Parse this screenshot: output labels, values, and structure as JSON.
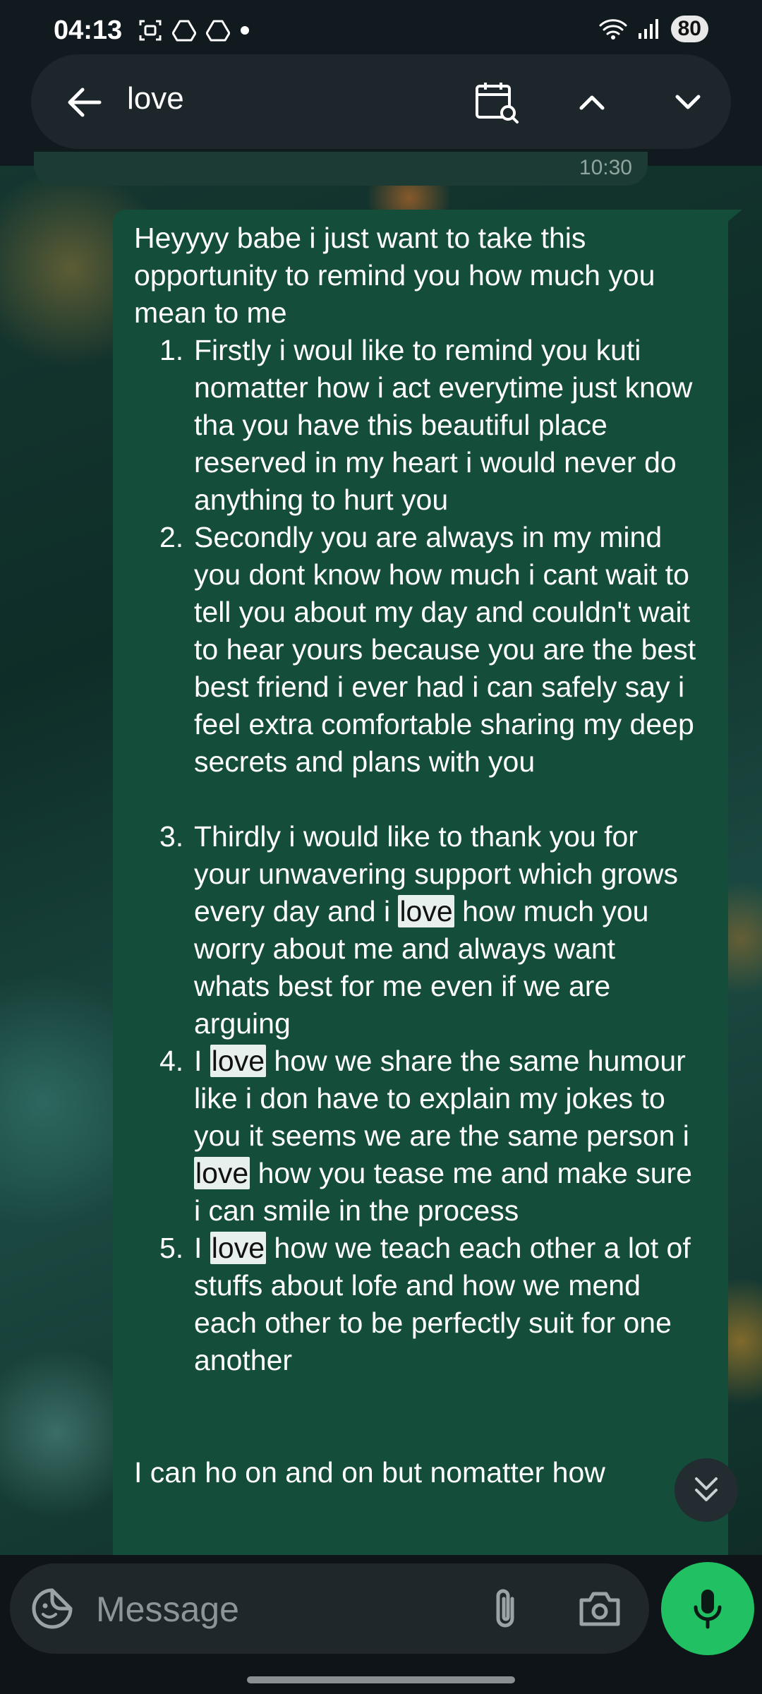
{
  "status_bar": {
    "time": "04:13",
    "battery": "80",
    "left_icons": [
      "screenshot-icon",
      "drive-icon",
      "drive-icon",
      "dot-icon"
    ],
    "right_icons": [
      "wifi-icon",
      "signal-icon"
    ]
  },
  "search": {
    "query": "love",
    "icons": [
      "back-arrow-icon",
      "calendar-search-icon",
      "chevron-up-icon",
      "chevron-down-icon"
    ]
  },
  "previous_message": {
    "time": "10:30"
  },
  "message": {
    "intro": "Heyyyy babe i just want to take this opportunity to remind you how  much you mean to me",
    "items": [
      {
        "num": "1.",
        "text": "Firstly i woul like to remind you kuti nomatter how i act everytime just know tha you have this beautiful place reserved in my heart i would never do anything to hurt you"
      },
      {
        "num": "2.",
        "text": "Secondly you are always in my mind you dont know how much i cant wait to tell you about my day and couldn't wait to hear yours because you are the best best friend i ever had i can safely say i feel extra comfortable sharing my deep secrets and plans with you"
      },
      {
        "num": "3.",
        "pre": "Thirdly i would like to thank you for your unwavering support which grows every day and i ",
        "hl": "love",
        "post": " how much you worry about me and always want whats best for me even if we are arguing"
      },
      {
        "num": "4.",
        "pre1": "I ",
        "hl1": "love",
        "mid": " how we share the same humour like i don have to explain my jokes to you it seems we are the same person i ",
        "hl2": "love",
        "post": " how you tease me and make sure i can smile in the process"
      },
      {
        "num": "5.",
        "pre": "I ",
        "hl": "love",
        "post": " how we teach each other a lot of stuffs about lofe and how we mend each other to be perfectly suit for one another"
      }
    ],
    "outro": "I can ho on and on but nomatter how"
  },
  "composer": {
    "placeholder": "Message",
    "icons": [
      "emoji-sticker-icon",
      "attach-icon",
      "camera-icon",
      "mic-icon"
    ]
  },
  "colors": {
    "bubble": "#144d3a",
    "highlight": "#e8f0ee",
    "mic_button": "#21c063",
    "header": "#111a1f"
  }
}
